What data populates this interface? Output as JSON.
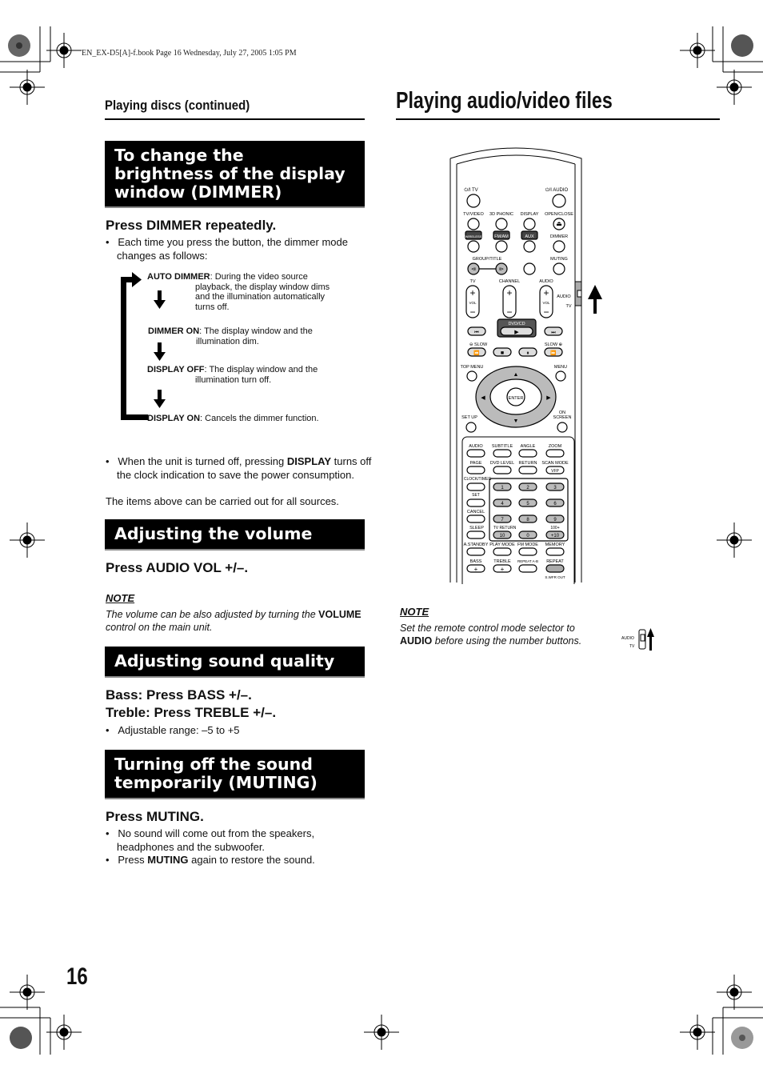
{
  "print_info": "EN_EX-D5[A]-f.book  Page 16  Wednesday, July 27, 2005  1:05 PM",
  "left_header": "Playing discs (continued)",
  "right_header": "Playing audio/video files",
  "page_number": "16",
  "sections": {
    "dimmer": {
      "title_lines": [
        "To change the",
        "brightness of the display",
        "window (DIMMER)"
      ],
      "instruction": "Press DIMMER repeatedly.",
      "bullet": "Each time you press the button, the dimmer mode changes as follows:",
      "cycle": [
        {
          "mode": "AUTO DIMMER",
          "desc_lines": [
            ": During the video source",
            "playback, the display window dims",
            "and the illumination automatically",
            "turns off."
          ]
        },
        {
          "mode": "DIMMER ON",
          "desc_lines": [
            ": The display window and the",
            "illumination dim."
          ]
        },
        {
          "mode": "DISPLAY OFF",
          "desc_lines": [
            ": The display window and the",
            "illumination turn off."
          ]
        },
        {
          "mode": "DISPLAY ON",
          "desc_lines": [
            ": Cancels the dimmer function."
          ]
        }
      ],
      "bullet2_pre": "When the unit is turned off, pressing ",
      "bullet2_bold": "DISPLAY",
      "bullet2_post": " turns off the clock indication to save the power consumption.",
      "footer": "The items above can be carried out for all sources."
    },
    "volume": {
      "title": "Adjusting the volume",
      "instruction": "Press AUDIO VOL +/–.",
      "note_title": "NOTE",
      "note_pre": "The volume can be also adjusted by turning the ",
      "note_bold": "VOLUME",
      "note_post": " control on the main unit."
    },
    "sound_quality": {
      "title": "Adjusting sound quality",
      "instruction1": "Bass: Press BASS +/–.",
      "instruction2": "Treble: Press TREBLE +/–.",
      "bullet": "Adjustable range: –5 to +5"
    },
    "muting": {
      "title_lines": [
        "Turning off the sound",
        "temporarily (MUTING)"
      ],
      "instruction": "Press MUTING.",
      "bullet1": "No sound will come out from the speakers, headphones and the subwoofer.",
      "bullet2_pre": "Press ",
      "bullet2_bold": "MUTING",
      "bullet2_post": " again to restore the sound."
    }
  },
  "right_note": {
    "title": "NOTE",
    "line1": "Set the remote control mode selector to",
    "bold": "AUDIO",
    "line2_post": " before using the number buttons.",
    "selector_labels": [
      "AUDIO",
      "TV"
    ]
  },
  "remote": {
    "top_labels": [
      "⏻/I TV",
      "⏻/I AUDIO"
    ],
    "row2": [
      "TV/VIDEO",
      "3D PHONIC",
      "DISPLAY",
      "OPEN/CLOSE"
    ],
    "row3": [
      "WIRELESS",
      "FM/AM",
      "AUX",
      "DIMMER"
    ],
    "group_title": "GROUP/TITLE",
    "muting": "MUTING",
    "vol_labels": [
      "TV",
      "CHANNEL",
      "AUDIO"
    ],
    "vol": "VOL",
    "mode_labels": [
      "AUDIO",
      "TV"
    ],
    "dvdcd": "DVD/CD",
    "slow_left": "⊖ SLOW",
    "slow_right": "SLOW ⊕",
    "top_menu": "TOP MENU",
    "menu": "MENU",
    "enter": "ENTER",
    "set_up": "SET UP",
    "on_screen": [
      "ON",
      "SCREEN"
    ],
    "lower_row1": [
      "AUDIO",
      "SUBTITLE",
      "ANGLE",
      "ZOOM"
    ],
    "lower_row2": [
      "PAGE",
      "DVD LEVEL",
      "RETURN",
      "SCAN MODE"
    ],
    "vfp": "VFP",
    "clock_timer": "CLOCK/TIMER",
    "set": "SET",
    "cancel": "CANCEL",
    "sleep": "SLEEP",
    "tv_return": "TV RETURN",
    "hundred_plus": "100+",
    "numbers": [
      "1",
      "2",
      "3",
      "4",
      "5",
      "6",
      "7",
      "8",
      "9",
      "10",
      "0",
      "+10"
    ],
    "lower_row5": [
      "A.STANDBY",
      "PLAY MODE",
      "FM MODE",
      "MEMORY"
    ],
    "lower_row6": [
      "BASS",
      "TREBLE",
      "REPEAT A-B",
      "REPEAT"
    ],
    "swfr_out": "S.WFR OUT"
  }
}
